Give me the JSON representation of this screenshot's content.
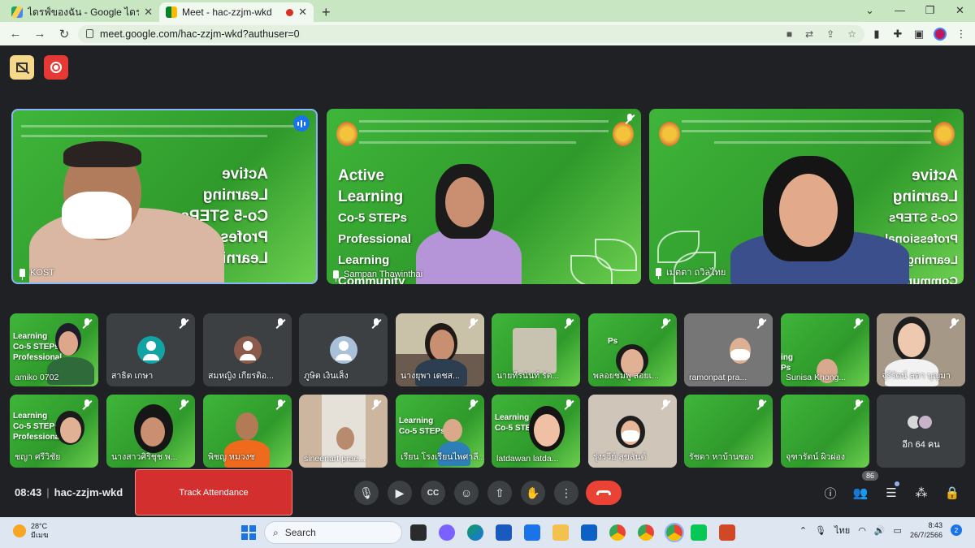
{
  "browser": {
    "tabs": [
      {
        "title": "ไดรฟ์ของฉัน - Google ไดรฟ์",
        "active": false
      },
      {
        "title": "Meet - hac-zzjm-wkd",
        "active": true
      }
    ],
    "url": "meet.google.com/hac-zzjm-wkd?authuser=0"
  },
  "slide": {
    "title_lines": [
      "Active",
      "Learning",
      "Co-5 STEPs",
      "Professional",
      "Learning",
      "Community"
    ]
  },
  "featured": [
    {
      "name": "KOST"
    },
    {
      "name": "Sampan Thawinthai"
    },
    {
      "name": "เมตตา ถวิลไทย"
    }
  ],
  "participants_row1": [
    {
      "name": "amiko 0702"
    },
    {
      "name": "สาธิต เกษา"
    },
    {
      "name": "สมหญิง เกียรติอ..."
    },
    {
      "name": "ภูษิต เงินเส็ง"
    },
    {
      "name": "นางยุพา เดชส..."
    },
    {
      "name": "นายทีรนันท์ รัต..."
    },
    {
      "name": "พลอยชมพู สอยเ..."
    },
    {
      "name": "ramonpat pra..."
    },
    {
      "name": "Sunisa Khong..."
    },
    {
      "name": "จุรีรัตน์ ลดา บุญมา"
    }
  ],
  "participants_row2": [
    {
      "name": "ชญา ศรีวิชัย"
    },
    {
      "name": "นางสาวศิริชุช พ..."
    },
    {
      "name": "พิชญ หมวงช"
    },
    {
      "name": "sineenart prae..."
    },
    {
      "name": "เรียน โรงเรียนไพศาลี..."
    },
    {
      "name": "latdawan latda..."
    },
    {
      "name": "รุ่งรวีย์ สุขสันต์"
    },
    {
      "name": "รัชดา หาบ้านซอง"
    },
    {
      "name": "จุฑารัตน์ ผิวผ่อง"
    }
  ],
  "more": {
    "label": "อีก 64 คน"
  },
  "meeting": {
    "time": "08:43",
    "code": "hac-zzjm-wkd",
    "track_label": "Track Attendance",
    "participant_count": "86"
  },
  "taskbar": {
    "temp": "28°C",
    "weather": "มีเมฆ",
    "search": "Search",
    "lang": "ไทย",
    "clock_time": "8:43",
    "clock_date": "26/7/2566",
    "notification_count": "2"
  },
  "colors": {
    "meet_bg": "#202124",
    "tile_bg": "#3c4043",
    "slide_green": "#3fb53a",
    "end_call_red": "#ea4335",
    "track_red": "#d32f2f",
    "speaking_blue": "#8ab4f8"
  },
  "icons": [
    "present-off-icon",
    "record-icon",
    "mic-icon",
    "camera-icon",
    "captions-icon",
    "emoji-icon",
    "present-icon",
    "raise-hand-icon",
    "more-icon",
    "end-call-icon",
    "info-icon",
    "people-icon",
    "chat-icon",
    "activities-icon",
    "host-controls-icon"
  ]
}
